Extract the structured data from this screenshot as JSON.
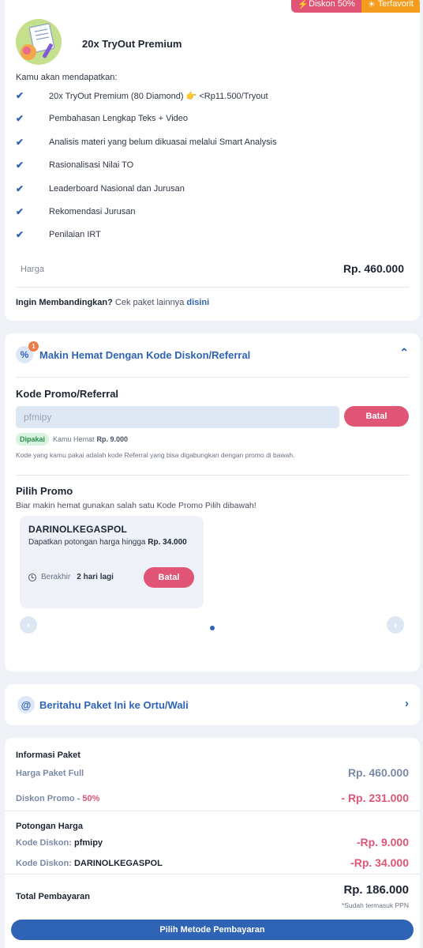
{
  "package": {
    "badge_discount": "Diskon 50%",
    "badge_favorite": "Terfavorit",
    "title": "20x TryOut Premium",
    "benefits_intro": "Kamu akan mendapatkan:",
    "benefits": [
      "20x TryOut Premium (80 Diamond) 👉 <Rp11.500/Tryout",
      "Pembahasan Lengkap Teks + Video",
      "Analisis materi yang belum dikuasai melalui Smart Analysis",
      "Rasionalisasi Nilai TO",
      "Leaderboard Nasional dan Jurusan",
      "Rekomendasi Jurusan",
      "Penilaian IRT"
    ],
    "price_label": "Harga",
    "price_value": "Rp. 460.000",
    "compare_question": "Ingin Membandingkan?",
    "compare_text": "Cek paket lainnya",
    "compare_link": "disini"
  },
  "promo": {
    "header_title": "Makin Hemat Dengan Kode Diskon/Referral",
    "notification_count": "1",
    "code_section_title": "Kode Promo/Referral",
    "code_input_value": "pfmipy",
    "cancel_label": "Batal",
    "used_badge": "Dipakai",
    "saving_text": "Kamu Hemat",
    "saving_value": "Rp. 9.000",
    "referral_note": "Kode yang kamu pakai adalah kode Referral yang bisa digabungkan dengan promo di bawah.",
    "pick_title": "Pilih Promo",
    "pick_subtitle": "Biar makin hemat gunakan salah satu Kode Promo Pilih dibawah!",
    "card": {
      "code": "DARINOLKEGASPOL",
      "desc_text": "Dapatkan potongan harga hingga",
      "desc_value": "Rp. 34.000",
      "expires_label": "Berakhir",
      "expires_value": "2 hari lagi",
      "cancel_label": "Batal"
    }
  },
  "notify": {
    "title": "Beritahu Paket Ini ke Ortu/Wali"
  },
  "summary": {
    "info_title": "Informasi Paket",
    "full_price_label": "Harga Paket Full",
    "full_price_value": "Rp. 460.000",
    "discount_label": "Diskon Promo -",
    "discount_percent": "50%",
    "discount_value": "- Rp. 231.000",
    "cut_title": "Potongan Harga",
    "code_label": "Kode Diskon:",
    "code1_name": "pfmipy",
    "code1_value": "-Rp. 9.000",
    "code2_name": "DARINOLKEGASPOL",
    "code2_value": "-Rp. 34.000",
    "total_label": "Total Pembayaran",
    "total_value": "Rp. 186.000",
    "ppn_note": "*Sudah termasuk PPN",
    "pay_button": "Pilih Metode Pembayaran"
  }
}
